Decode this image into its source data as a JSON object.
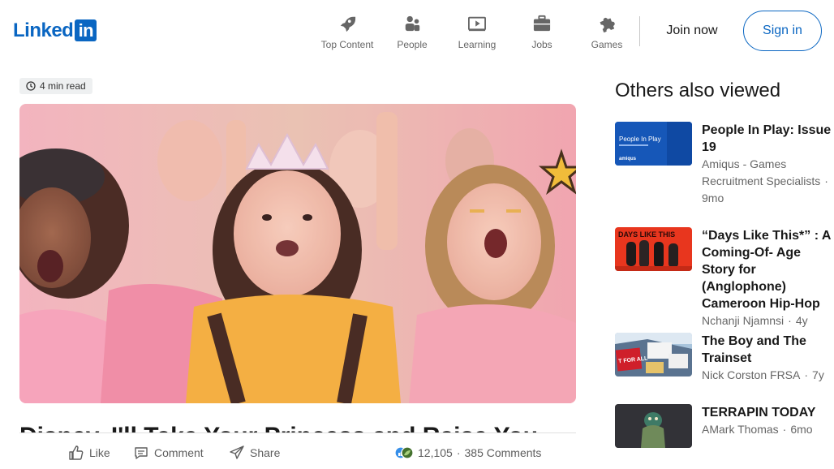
{
  "header": {
    "logo_text": "Linked",
    "logo_in": "in",
    "nav": [
      {
        "label": "Top Content",
        "icon": "rocket-icon"
      },
      {
        "label": "People",
        "icon": "people-icon"
      },
      {
        "label": "Learning",
        "icon": "learning-icon"
      },
      {
        "label": "Jobs",
        "icon": "briefcase-icon"
      },
      {
        "label": "Games",
        "icon": "puzzle-icon"
      }
    ],
    "join_label": "Join now",
    "signin_label": "Sign in"
  },
  "article": {
    "read_time": "4 min read",
    "title": "Disney, I'll Take Your Princess and Raise You",
    "actions": {
      "like": "Like",
      "comment": "Comment",
      "share": "Share"
    },
    "reaction_count": "12,105",
    "comments": "385 Comments"
  },
  "sidebar": {
    "heading": "Others also viewed",
    "cards": [
      {
        "title": "People In Play: Issue 19",
        "author_line1": "Amiqus - Games",
        "author_line2": "Recruitment Specialists",
        "age": "9mo",
        "thumb_text": "People In Play",
        "thumb_brand": "amiqus"
      },
      {
        "title": "“Days Like This*” : A Coming-Of- Age Story for (Anglophone) Cameroon Hip-Hop",
        "author": "Nchanji Njamnsi",
        "age": "4y",
        "thumb_text": "DAYS LIKE THIS"
      },
      {
        "title": "The Boy and The Trainset",
        "author": "Nick Corston FRSA",
        "age": "7y",
        "thumb_text": "T FOR ALL"
      },
      {
        "title": "TERRAPIN TODAY",
        "author": "AMark Thomas",
        "age": "6mo"
      }
    ]
  },
  "colors": {
    "brand": "#0a66c2",
    "text": "#191919",
    "muted": "#666666"
  }
}
